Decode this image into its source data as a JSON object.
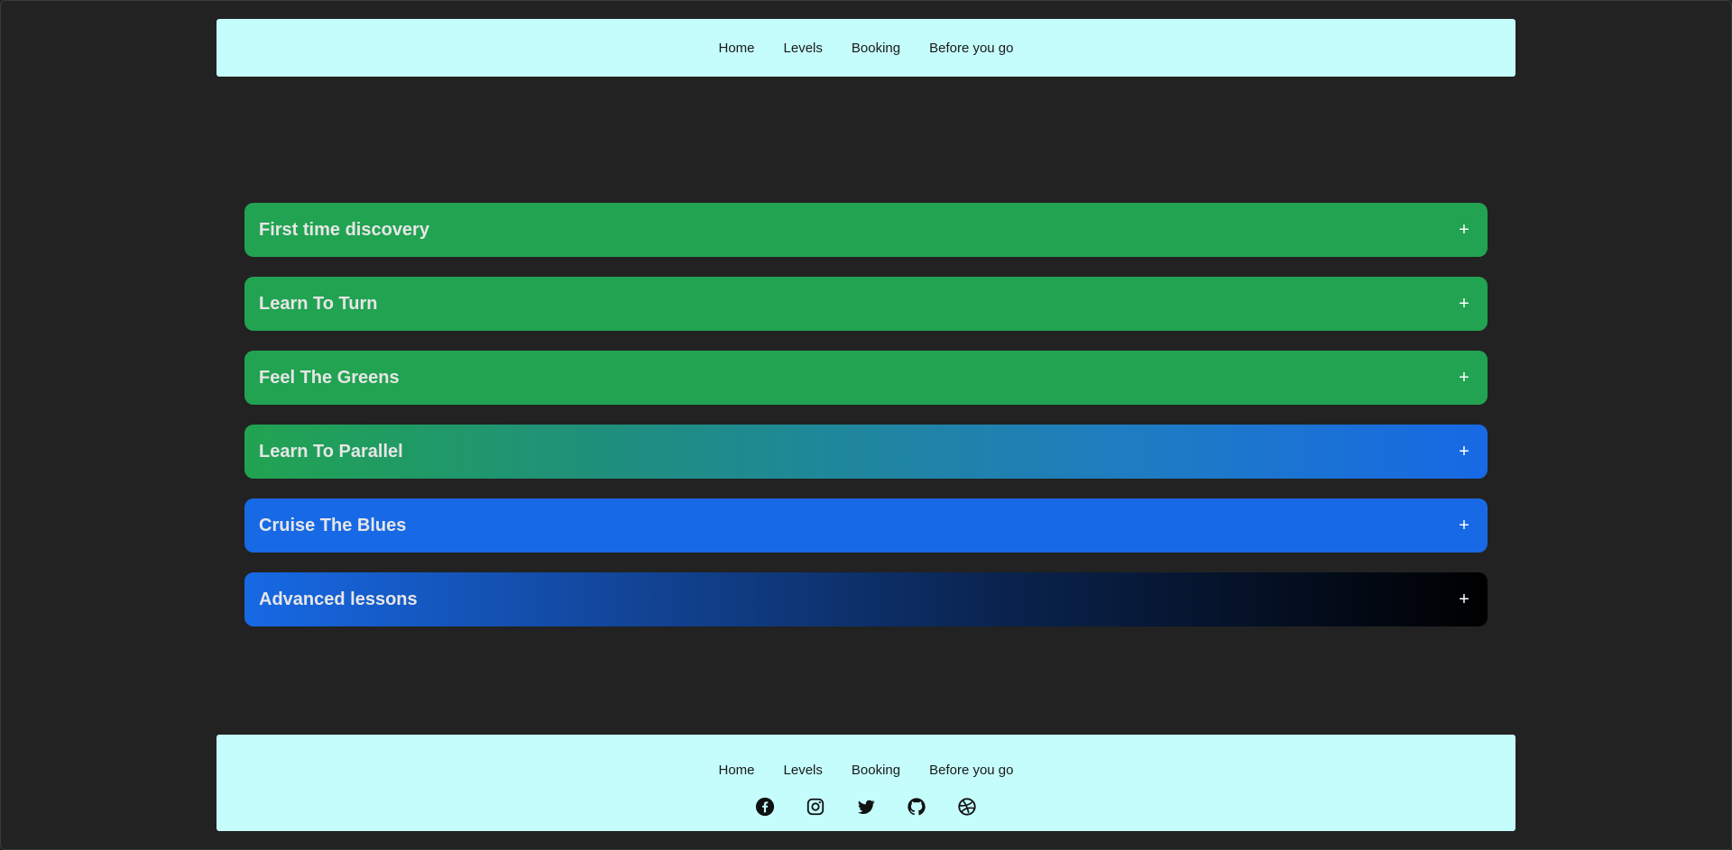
{
  "header": {
    "nav": [
      {
        "label": "Home"
      },
      {
        "label": "Levels"
      },
      {
        "label": "Booking"
      },
      {
        "label": "Before you go"
      }
    ]
  },
  "accordion": {
    "items": [
      {
        "title": "First time discovery",
        "icon": "plus-icon",
        "symbol": "+"
      },
      {
        "title": "Learn To Turn",
        "icon": "plus-icon",
        "symbol": "+"
      },
      {
        "title": "Feel The Greens",
        "icon": "plus-icon",
        "symbol": "+"
      },
      {
        "title": "Learn To Parallel",
        "icon": "plus-icon",
        "symbol": "+"
      },
      {
        "title": "Cruise The Blues",
        "icon": "plus-icon",
        "symbol": "+"
      },
      {
        "title": "Advanced lessons",
        "icon": "plus-icon",
        "symbol": "+"
      }
    ]
  },
  "footer": {
    "nav": [
      {
        "label": "Home"
      },
      {
        "label": "Levels"
      },
      {
        "label": "Booking"
      },
      {
        "label": "Before you go"
      }
    ],
    "socials": [
      {
        "icon": "facebook-icon"
      },
      {
        "icon": "instagram-icon"
      },
      {
        "icon": "twitter-icon"
      },
      {
        "icon": "github-icon"
      },
      {
        "icon": "dribbble-icon"
      }
    ]
  },
  "colors": {
    "background": "#222222",
    "bar": "#c5fcfc",
    "green": "#21a351",
    "blue": "#1769e5",
    "black": "#000000",
    "title_text": "#e6e6e6"
  }
}
